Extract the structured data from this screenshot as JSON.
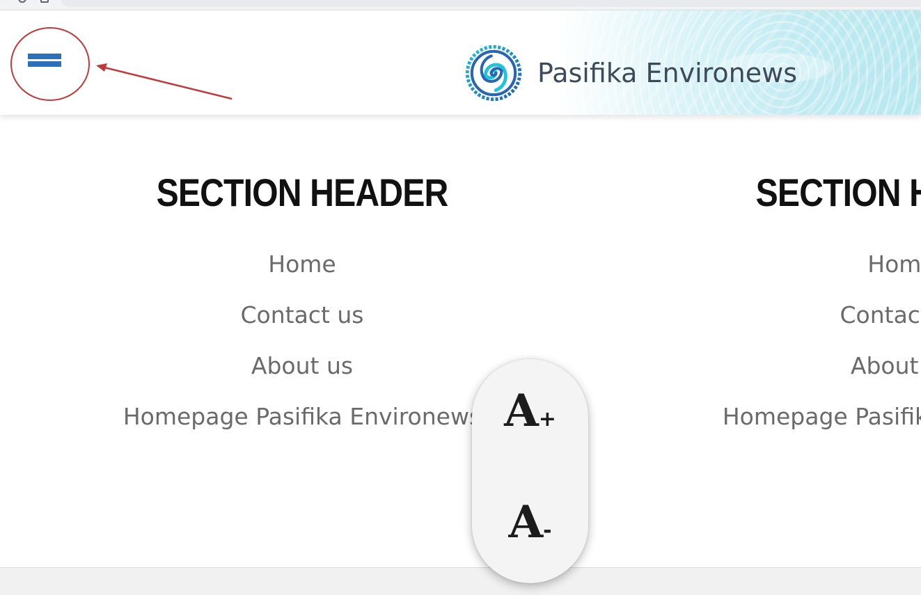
{
  "site": {
    "brand_name": "Pasifika Environews",
    "logo_icon": "spiral-gear-logo-icon",
    "menu_icon": "hamburger-menu-icon"
  },
  "colors": {
    "menu_bar": "#2c6fbb",
    "annotation": "#c0393b",
    "brand_text": "#3d4a59",
    "link_text": "#6a6a6a",
    "header_accent": "#b6e7ef"
  },
  "footer": {
    "columns": [
      {
        "heading": "SECTION HEADER",
        "links": [
          "Home",
          "Contact us",
          "About us",
          "Homepage Pasifika Environews"
        ]
      },
      {
        "heading": "SECTION HEADER",
        "links": [
          "Home",
          "Contact us",
          "About us",
          "Homepage Pasifika Environews"
        ]
      }
    ]
  },
  "font_widget": {
    "increase_letter": "A",
    "increase_sign": "+",
    "decrease_letter": "A",
    "decrease_sign": "-"
  }
}
